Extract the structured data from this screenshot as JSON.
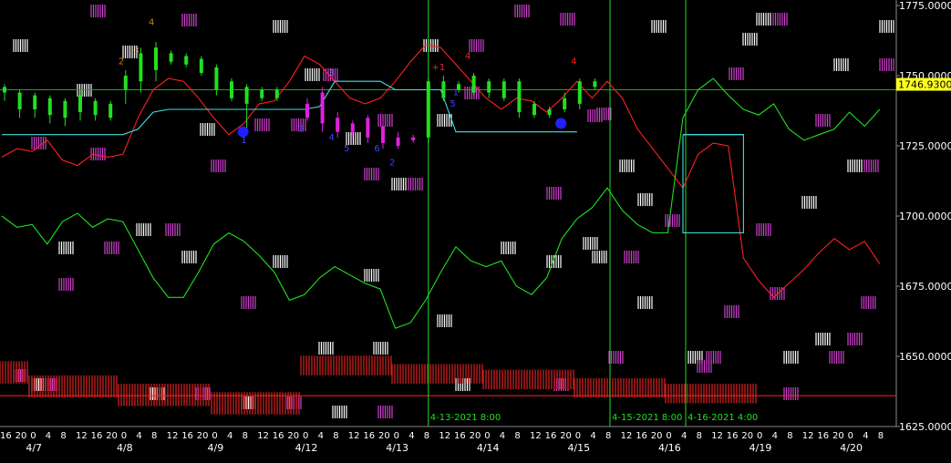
{
  "chart_data": {
    "type": "line",
    "ylim": [
      1625,
      1776
    ],
    "y_ticks": [
      "1775.00000",
      "1750.00000",
      "1725.00000",
      "1700.00000",
      "1675.00000",
      "1650.00000",
      "1625.00000"
    ],
    "y_tick_values": [
      1775,
      1750,
      1725,
      1700,
      1675,
      1650,
      1625
    ],
    "current_price_label": "1746.93000",
    "current_price": 1746.93,
    "hour_labels": [
      "16",
      "20",
      "0",
      "4",
      "8",
      "12",
      "16",
      "20",
      "0",
      "4",
      "8",
      "12",
      "16",
      "20",
      "0",
      "4",
      "8",
      "12",
      "16",
      "20",
      "0",
      "4",
      "8",
      "12",
      "16",
      "20",
      "0",
      "4",
      "8",
      "12",
      "16",
      "20",
      "0",
      "4",
      "8",
      "12",
      "16",
      "20",
      "0",
      "4",
      "8",
      "12",
      "16",
      "20",
      "0",
      "4",
      "8",
      "12",
      "16",
      "20",
      "0",
      "4",
      "8",
      "12",
      "16",
      "20",
      "0",
      "4",
      "8",
      "12",
      "16",
      "20",
      "0",
      "4",
      "8",
      "12",
      "16",
      "20",
      "0",
      "4",
      "8",
      "12",
      "16",
      "20",
      "0",
      "4",
      "8"
    ],
    "day_labels": [
      "4/7",
      "4/8",
      "4/9",
      "4/12",
      "4/13",
      "4/14",
      "4/15",
      "4/16",
      "4/19",
      "4/20"
    ],
    "day_label_slots": [
      2,
      8,
      14,
      20,
      26,
      32,
      38,
      44,
      50,
      56
    ],
    "vertical_markers": [
      {
        "label": "4-13-2021 8:00",
        "slot": 28
      },
      {
        "label": "4-15-2021 8:00",
        "slot": 40
      },
      {
        "label": "4-16-2021 4:00",
        "slot": 45
      }
    ],
    "horizontal_lines": [
      {
        "name": "red",
        "value": 1636,
        "color": "#ff2020"
      },
      {
        "name": "green",
        "value": 1745,
        "color": "#20a020"
      }
    ],
    "series": [
      {
        "color": "#ff2020",
        "x": [
          0,
          1,
          2,
          3,
          4,
          5,
          6,
          7,
          8,
          9,
          10,
          11,
          12,
          13,
          14,
          15,
          16,
          17,
          18,
          19,
          20,
          21,
          22,
          23,
          24,
          25,
          26,
          27,
          28,
          29,
          30,
          31,
          32,
          33,
          34,
          35,
          36,
          37,
          38,
          39,
          40,
          41,
          42,
          43,
          44,
          45,
          46,
          47,
          48,
          49,
          50,
          51,
          52,
          53,
          54,
          55,
          56,
          57,
          58
        ],
        "y": [
          1721,
          1724,
          1723,
          1727,
          1720,
          1718,
          1722,
          1721,
          1722,
          1735,
          1745,
          1749,
          1748,
          1742,
          1735,
          1729,
          1733,
          1740,
          1741,
          1748,
          1757,
          1754,
          1748,
          1742,
          1740,
          1742,
          1748,
          1755,
          1761,
          1760,
          1754,
          1748,
          1742,
          1738,
          1742,
          1741,
          1737,
          1742,
          1748,
          1742,
          1748,
          1742,
          1731,
          1724,
          1717,
          1710,
          1722,
          1726,
          1725,
          1685,
          1677,
          1671,
          1676,
          1681,
          1687,
          1692,
          1688,
          1691,
          1683
        ]
      },
      {
        "color": "#20e020",
        "x": [
          0,
          1,
          2,
          3,
          4,
          5,
          6,
          7,
          8,
          9,
          10,
          11,
          12,
          13,
          14,
          15,
          16,
          17,
          18,
          19,
          20,
          21,
          22,
          23,
          24,
          25,
          26,
          27,
          28,
          29,
          30,
          31,
          32,
          33,
          34,
          35,
          36,
          37,
          38,
          39,
          40,
          41,
          42,
          43,
          44,
          45,
          46,
          47,
          48,
          49,
          50,
          51,
          52,
          53,
          54,
          55,
          56,
          57,
          58
        ],
        "y": [
          1700,
          1696,
          1697,
          1690,
          1698,
          1701,
          1696,
          1699,
          1698,
          1688,
          1678,
          1671,
          1671,
          1680,
          1690,
          1694,
          1691,
          1686,
          1680,
          1670,
          1672,
          1678,
          1682,
          1679,
          1676,
          1674,
          1660,
          1662,
          1670,
          1680,
          1689,
          1684,
          1682,
          1684,
          1675,
          1672,
          1678,
          1692,
          1699,
          1703,
          1710,
          1702,
          1697,
          1694,
          1694,
          1735,
          1745,
          1749,
          1743,
          1738,
          1736,
          1740,
          1731,
          1727,
          1729,
          1731,
          1737,
          1732,
          1738
        ]
      },
      {
        "color": "#40e0e0",
        "x": [
          0,
          3,
          6,
          8,
          9,
          10,
          11,
          15,
          16,
          17,
          18,
          19,
          20,
          21,
          22,
          23,
          24,
          25,
          26,
          27,
          28,
          29,
          30,
          31,
          32,
          33,
          34,
          35,
          36,
          37,
          38
        ],
        "y": [
          1729,
          1729,
          1729,
          1729,
          1731,
          1737,
          1738,
          1738,
          1738,
          1738,
          1738,
          1738,
          1738,
          1739,
          1748,
          1748,
          1748,
          1748,
          1745,
          1745,
          1745,
          1745,
          1730,
          1730,
          1730,
          1730,
          1730,
          1730,
          1730,
          1730,
          1730
        ]
      },
      {
        "color": "#40e0e0",
        "x": [
          45,
          46,
          47,
          48,
          49
        ],
        "y": [
          1729,
          1729,
          1729,
          1729,
          1729
        ]
      }
    ],
    "annotations": [
      "2",
      "3",
      "4",
      "1",
      "2",
      "3",
      "4",
      "5",
      "6",
      "2",
      "+1",
      "4",
      "5",
      "1",
      "4"
    ],
    "price_markers": [
      {
        "slot": 16,
        "value": 1730
      },
      {
        "slot": 37,
        "value": 1733
      }
    ]
  }
}
